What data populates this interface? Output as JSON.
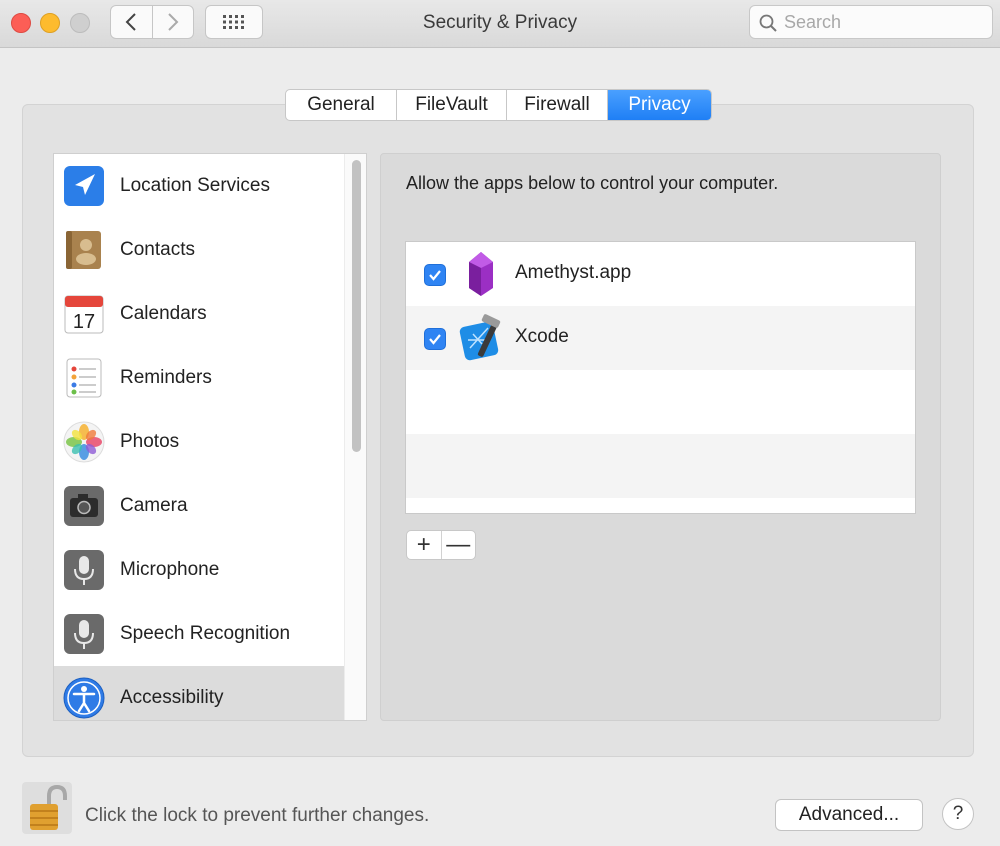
{
  "window": {
    "title": "Security & Privacy",
    "search_placeholder": "Search"
  },
  "tabs": [
    {
      "label": "General",
      "active": false
    },
    {
      "label": "FileVault",
      "active": false
    },
    {
      "label": "Firewall",
      "active": false
    },
    {
      "label": "Privacy",
      "active": true
    }
  ],
  "sidebar": {
    "items": [
      {
        "label": "Location Services",
        "icon": "location-arrow-icon"
      },
      {
        "label": "Contacts",
        "icon": "contacts-book-icon"
      },
      {
        "label": "Calendars",
        "icon": "calendar-icon",
        "icon_text": "17"
      },
      {
        "label": "Reminders",
        "icon": "reminders-list-icon"
      },
      {
        "label": "Photos",
        "icon": "photos-flower-icon"
      },
      {
        "label": "Camera",
        "icon": "camera-icon"
      },
      {
        "label": "Microphone",
        "icon": "microphone-icon"
      },
      {
        "label": "Speech Recognition",
        "icon": "speech-recognition-icon"
      },
      {
        "label": "Accessibility",
        "icon": "accessibility-icon",
        "selected": true
      }
    ]
  },
  "panel": {
    "description": "Allow the apps below to control your computer.",
    "apps": [
      {
        "name": "Amethyst.app",
        "checked": true,
        "icon": "amethyst-gem-icon"
      },
      {
        "name": "Xcode",
        "checked": true,
        "icon": "xcode-hammer-icon"
      }
    ],
    "add_label": "+",
    "remove_label": "—"
  },
  "footer": {
    "lock_text": "Click the lock to prevent further changes.",
    "advanced_label": "Advanced...",
    "help_label": "?"
  },
  "colors": {
    "accent": "#2f84f3",
    "close": "#fc5e56",
    "minimize": "#fdbb2e"
  }
}
